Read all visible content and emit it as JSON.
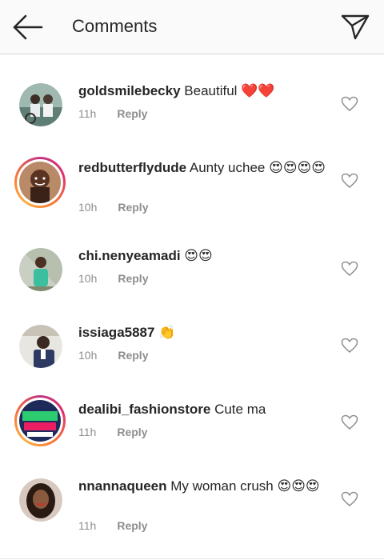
{
  "header": {
    "title": "Comments",
    "back_icon": "arrow-left-icon",
    "direct_icon": "paper-plane-icon"
  },
  "comments": [
    {
      "username": "goldsmilebecky",
      "text": "Beautiful",
      "emoji": "❤️❤️",
      "time": "11h",
      "reply": "Reply",
      "story_ring": false
    },
    {
      "username": "redbutterflydude",
      "text": "Aunty uchee",
      "emoji": "😍😍😍😍",
      "time": "10h",
      "reply": "Reply",
      "story_ring": true
    },
    {
      "username": "chi.nenyeamadi",
      "text": "",
      "emoji": "😍😍",
      "time": "10h",
      "reply": "Reply",
      "story_ring": false
    },
    {
      "username": "issiaga5887",
      "text": "",
      "emoji": "👏",
      "time": "10h",
      "reply": "Reply",
      "story_ring": false
    },
    {
      "username": "dealibi_fashionstore",
      "text": "Cute ma",
      "emoji": "",
      "time": "11h",
      "reply": "Reply",
      "story_ring": true
    },
    {
      "username": "nnannaqueen",
      "text": "My woman crush",
      "emoji": "😍😍😍",
      "time": "11h",
      "reply": "Reply",
      "story_ring": false
    }
  ],
  "colors": {
    "text": "#262626",
    "secondary": "#8e8e8e",
    "header_bg": "#fafafa"
  }
}
